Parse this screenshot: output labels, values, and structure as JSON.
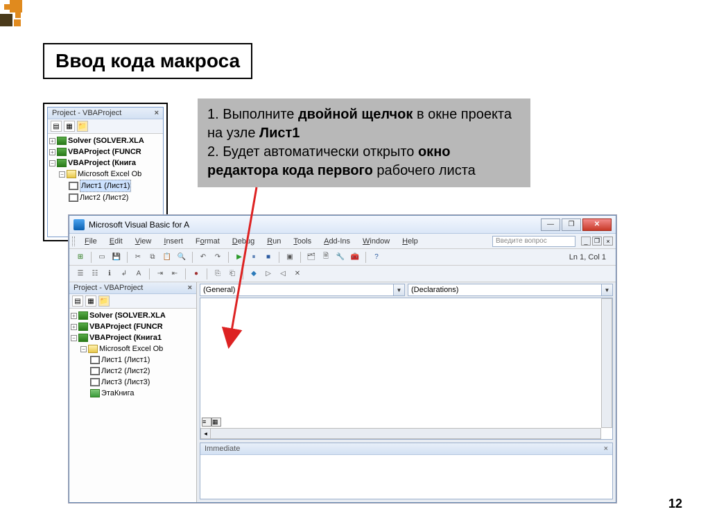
{
  "slide": {
    "title": "Ввод кода макроса",
    "page_number": "12"
  },
  "instruction": {
    "line1_a": "1. Выполните ",
    "line1_b": "двойной щелчок",
    "line1_c": " в окне проекта на узле ",
    "line1_d": "Лист1",
    "line2_a": "2. Будет автоматически открыто ",
    "line2_b": "окно редактора кода первого",
    "line2_c": " рабочего листа"
  },
  "panel_small": {
    "title": "Project - VBAProject",
    "tree": {
      "solver": "Solver (SOLVER.XLA",
      "funcr": "VBAProject (FUNCR",
      "book": "VBAProject (Книга",
      "excel_obj": "Microsoft Excel Ob",
      "sheet1": "Лист1 (Лист1)",
      "sheet2": "Лист2 (Лист2)"
    }
  },
  "vba": {
    "title": "Microsoft Visual Basic for A",
    "help_placeholder": "Введите вопрос",
    "menu": {
      "file": "File",
      "edit": "Edit",
      "view": "View",
      "insert": "Insert",
      "format": "Format",
      "debug": "Debug",
      "run": "Run",
      "tools": "Tools",
      "addins": "Add-Ins",
      "window": "Window",
      "help": "Help"
    },
    "status": "Ln 1, Col 1",
    "project": {
      "title": "Project - VBAProject",
      "solver": "Solver (SOLVER.XLA",
      "funcr": "VBAProject (FUNCR",
      "book": "VBAProject (Книга1",
      "excel_obj": "Microsoft Excel Ob",
      "sheet1": "Лист1 (Лист1)",
      "sheet2": "Лист2 (Лист2)",
      "sheet3": "Лист3 (Лист3)",
      "thisbook": "ЭтаКнига"
    },
    "dropdown": {
      "general": "(General)",
      "declarations": "(Declarations)"
    },
    "immediate": "Immediate"
  }
}
